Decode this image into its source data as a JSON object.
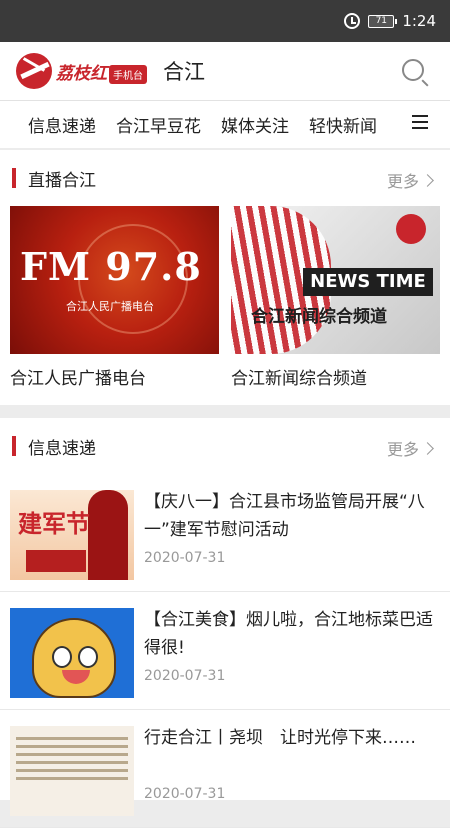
{
  "status": {
    "battery": "71",
    "time": "1:24"
  },
  "header": {
    "brand": "荔枝红",
    "badge": "手机台",
    "city": "合江"
  },
  "nav": {
    "tabs": [
      "信息速递",
      "合江早豆花",
      "媒体关注",
      "轻快新闻"
    ]
  },
  "live": {
    "title": "直播合江",
    "more": "更多",
    "items": [
      {
        "caption": "合江人民广播电台",
        "thumb_big": "FM 97.8",
        "thumb_sub": "合江人民广播电台"
      },
      {
        "caption": "合江新闻综合频道",
        "thumb_banner": "NEWS TIME",
        "thumb_zh": "合江新闻综合频道"
      }
    ]
  },
  "news": {
    "title": "信息速递",
    "more": "更多",
    "thumb1_text": "建军节",
    "items": [
      {
        "title": "【庆八一】合江县市场监管局开展“八一”建军节慰问活动",
        "date": "2020-07-31"
      },
      {
        "title": "【合江美食】烟儿啦，合江地标菜巴适得很!",
        "date": "2020-07-31"
      },
      {
        "title": "行走合江丨尧坝　让时光停下来……",
        "date": "2020-07-31"
      }
    ]
  }
}
